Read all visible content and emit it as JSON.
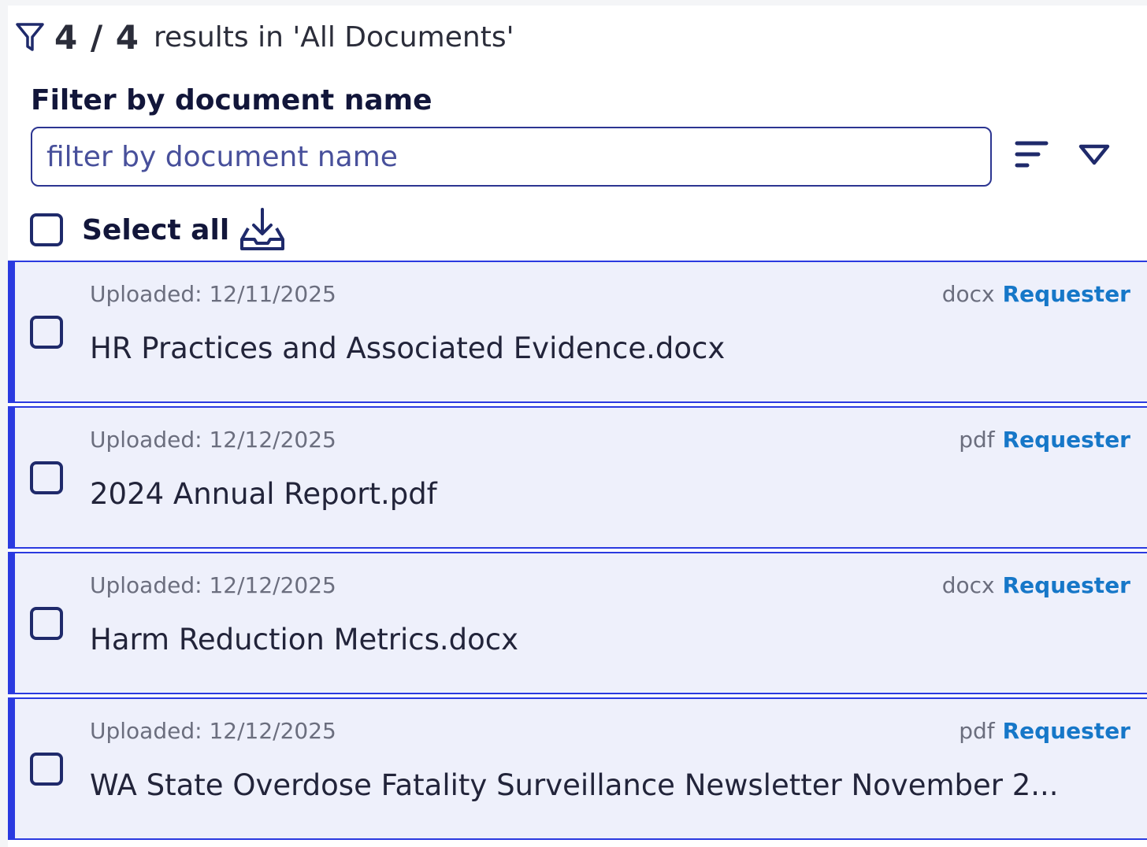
{
  "header": {
    "count": "4 / 4",
    "results_text": "results in 'All Documents'"
  },
  "filter": {
    "label": "Filter by document name",
    "placeholder": "filter by document name",
    "value": ""
  },
  "select_all": {
    "label": "Select all"
  },
  "documents": [
    {
      "uploaded": "Uploaded: 12/11/2025",
      "type": "docx",
      "role": "Requester",
      "name": "HR Practices and Associated Evidence.docx"
    },
    {
      "uploaded": "Uploaded: 12/12/2025",
      "type": "pdf",
      "role": "Requester",
      "name": "2024 Annual Report.pdf"
    },
    {
      "uploaded": "Uploaded: 12/12/2025",
      "type": "docx",
      "role": "Requester",
      "name": "Harm Reduction Metrics.docx"
    },
    {
      "uploaded": "Uploaded: 12/12/2025",
      "type": "pdf",
      "role": "Requester",
      "name": "WA State Overdose Fatality Surveillance Newsletter November 2..."
    }
  ],
  "icons": {
    "filter": "filter-icon",
    "sort": "sort-lines-icon",
    "dropdown": "triangle-down-icon",
    "download": "download-tray-icon"
  },
  "colors": {
    "accent": "#2a3ae0",
    "navy": "#1f2a6b",
    "role_link": "#1677c8",
    "row_bg": "#eef0fb"
  }
}
